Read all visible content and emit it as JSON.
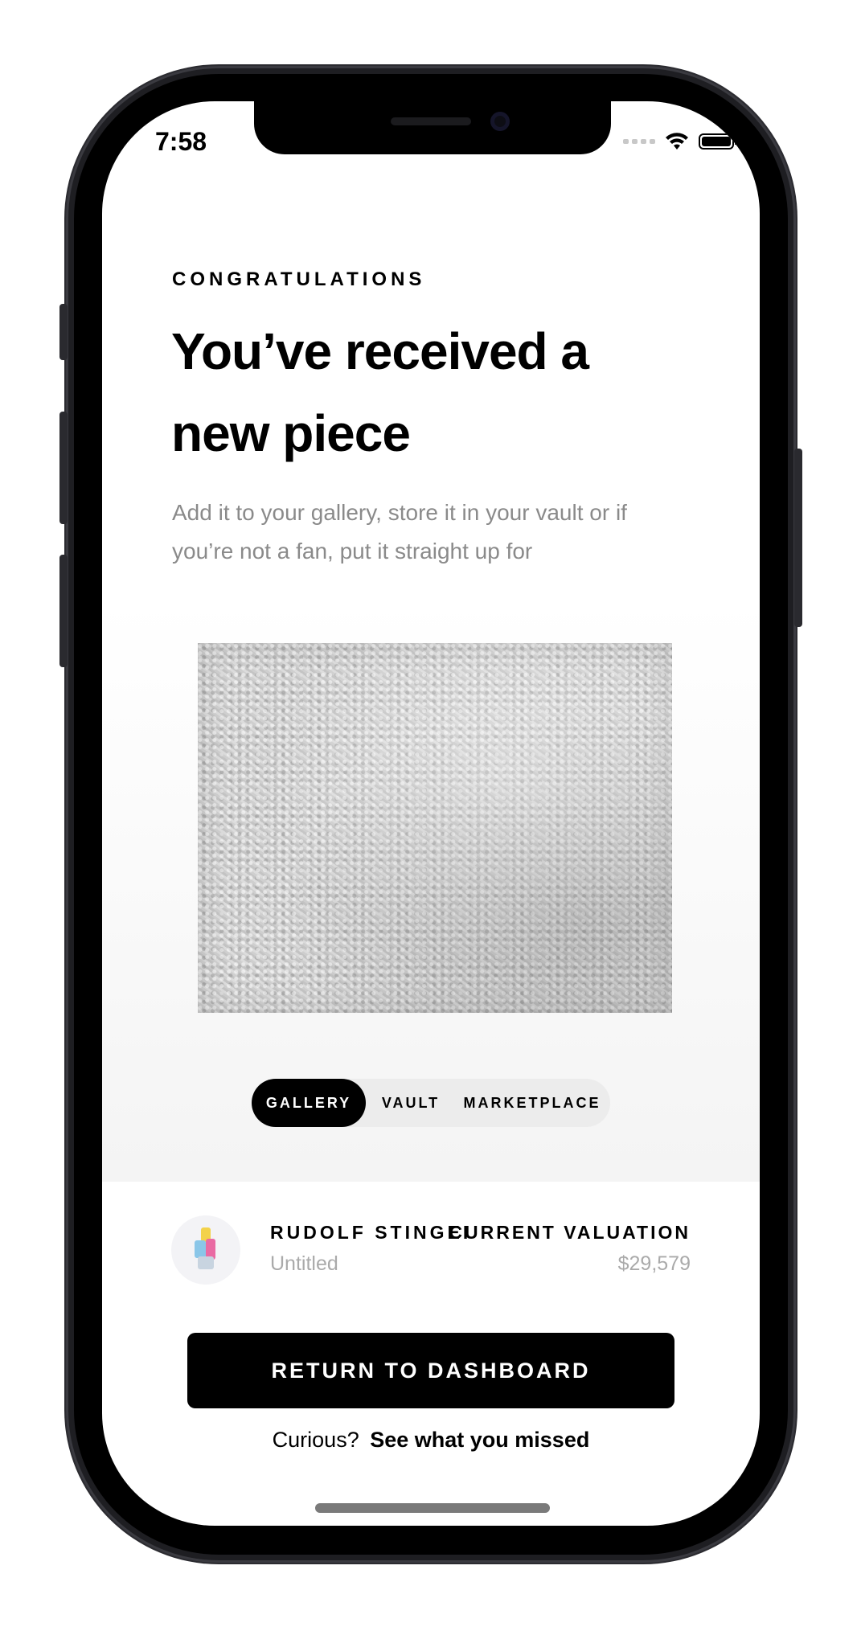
{
  "status_bar": {
    "time": "7:58",
    "icons": [
      "cellular-signal-icon",
      "wifi-icon",
      "battery-icon"
    ]
  },
  "header": {
    "eyebrow": "CONGRATULATIONS",
    "title": "You’ve received a new piece",
    "subtitle": "Add it to your gallery, store it in your vault or if you’re not a fan, put it straight up for"
  },
  "destination_selector": {
    "options": [
      {
        "label": "GALLERY",
        "selected": true
      },
      {
        "label": "VAULT",
        "selected": false
      },
      {
        "label": "MARKETPLACE",
        "selected": false
      }
    ]
  },
  "piece": {
    "artist": "RUDOLF STINGEI",
    "title": "Untitled",
    "valuation_label": "CURRENT VALUATION",
    "valuation_value": "$29,579"
  },
  "actions": {
    "primary_label": "RETURN TO DASHBOARD",
    "footer_prefix": "Curious?",
    "footer_link": "See what you missed"
  },
  "colors": {
    "primary": "#000000",
    "muted_text": "#8a8a8a",
    "selector_bg": "#ececec",
    "background": "#ffffff"
  }
}
